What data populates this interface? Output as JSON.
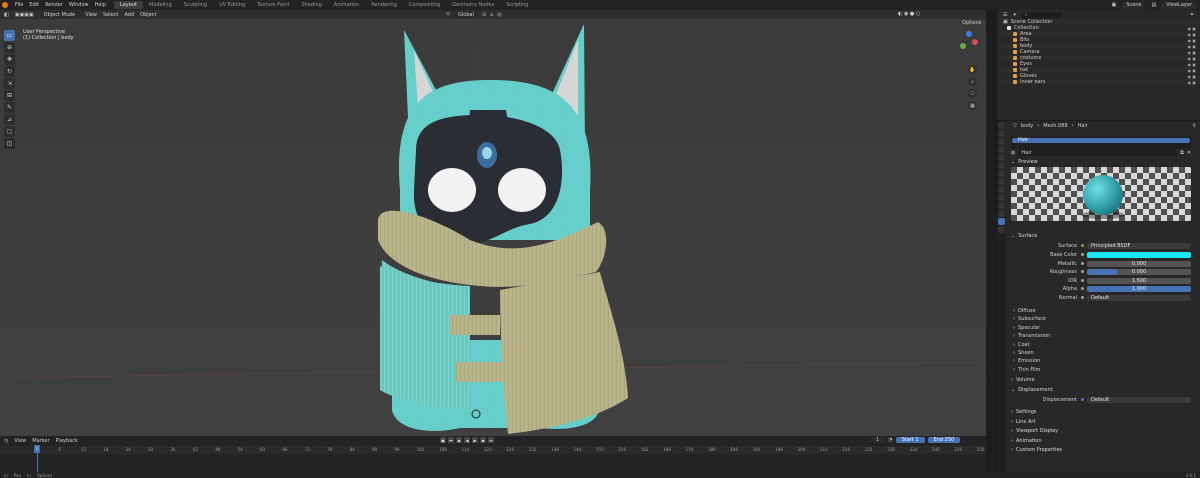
{
  "menu": {
    "items": [
      "File",
      "Edit",
      "Render",
      "Window",
      "Help"
    ]
  },
  "workspaces": {
    "items": [
      "Layout",
      "Modeling",
      "Sculpting",
      "UV Editing",
      "Texture Paint",
      "Shading",
      "Animation",
      "Rendering",
      "Compositing",
      "Geometry Nodes",
      "Scripting"
    ],
    "active": "Layout"
  },
  "top_right": {
    "scene": "Scene",
    "view_layer": "ViewLayer"
  },
  "viewport": {
    "mode": "Object Mode",
    "menus": [
      "View",
      "Select",
      "Add",
      "Object"
    ],
    "orientation": "Global",
    "options": "Options",
    "info_line1": "User Perspective",
    "info_line2": "(1) Collection | body",
    "toolbar_icons": [
      "select-box-icon",
      "cursor-icon",
      "move-icon",
      "rotate-icon",
      "scale-icon",
      "transform-icon",
      "annotate-icon",
      "measure-icon",
      "add-cube-icon",
      "add-object-icon"
    ]
  },
  "timeline": {
    "menus": [
      "View",
      "Marker",
      "Playback"
    ],
    "current_frame": "1",
    "start_label": "Start",
    "start": "1",
    "end_label": "End",
    "end": "250",
    "ticks": [
      "1",
      "6",
      "12",
      "18",
      "24",
      "30",
      "36",
      "42",
      "48",
      "54",
      "60",
      "66",
      "72",
      "78",
      "84",
      "90",
      "96",
      "102",
      "108",
      "114",
      "120",
      "126",
      "132",
      "138",
      "144",
      "150",
      "156",
      "162",
      "168",
      "174",
      "180",
      "186",
      "192",
      "198",
      "204",
      "210",
      "216",
      "222",
      "228",
      "234",
      "240",
      "246",
      "250"
    ]
  },
  "statusbar": {
    "left1": "Pan",
    "left2": "Options",
    "version": "3.0.1"
  },
  "outliner": {
    "title": "Scene Collection",
    "rows": [
      {
        "name": "Collection",
        "color": "#e0e0e0"
      },
      {
        "name": "Area",
        "color": "#e0a040"
      },
      {
        "name": "Bits",
        "color": "#e0a040"
      },
      {
        "name": "body",
        "color": "#e0a040"
      },
      {
        "name": "Camera",
        "color": "#e0a040"
      },
      {
        "name": "costume",
        "color": "#e0a040"
      },
      {
        "name": "Eyes",
        "color": "#e0a040"
      },
      {
        "name": "hat",
        "color": "#e0a040"
      },
      {
        "name": "Gloves",
        "color": "#e0a040"
      },
      {
        "name": "Inner ears",
        "color": "#e0a040"
      }
    ]
  },
  "properties": {
    "breadcrumb": [
      "body",
      "Mesh.088",
      "Hair"
    ],
    "slot": "Hair",
    "material": "Hair",
    "preview_label": "Preview",
    "surface_label": "Surface",
    "surface": {
      "label": "Surface",
      "value": "Principled BSDF"
    },
    "params": [
      {
        "label": "Base Color",
        "value": "",
        "type": "color",
        "color": "#19e6f0"
      },
      {
        "label": "Metallic",
        "value": "0.000",
        "fill": 0.0
      },
      {
        "label": "Roughness",
        "value": "0.000",
        "fill": 0.29
      },
      {
        "label": "IOR",
        "value": "1.500",
        "fill": 0.0
      },
      {
        "label": "Alpha",
        "value": "1.000",
        "fill": 1.0
      },
      {
        "label": "Normal",
        "value": "Default",
        "type": "plain"
      }
    ],
    "subpanels": [
      "Diffuse",
      "Subsurface",
      "Specular",
      "Transmission",
      "Coat",
      "Sheen",
      "Emission",
      "Thin Film"
    ],
    "volume": "Volume",
    "displacement": "Displacement",
    "displacement_field": {
      "label": "Displacement",
      "value": "Default"
    },
    "bottom_panels": [
      "Settings",
      "Line Art",
      "Viewport Display",
      "Animation",
      "Custom Properties"
    ]
  }
}
